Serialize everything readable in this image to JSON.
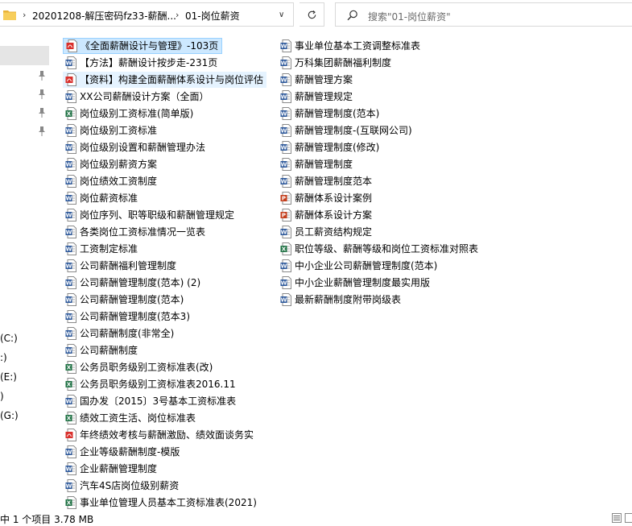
{
  "address": {
    "crumbs": [
      "20201208-解压密码fz33-薪酬...",
      "01-岗位薪资"
    ],
    "separator": "›"
  },
  "search": {
    "placeholder": "搜索\"01-岗位薪资\""
  },
  "nav": {
    "drives": [
      "(C:)",
      ":)",
      "(E:)",
      ")",
      "(G:)"
    ]
  },
  "files_col1": [
    {
      "name": "《全面薪酬设计与管理》-103页",
      "type": "pdf",
      "state": "selected"
    },
    {
      "name": "【方法】薪酬设计按步走-231页",
      "type": "word",
      "state": ""
    },
    {
      "name": "【资料】构建全面薪酬体系设计与岗位评估",
      "type": "pdf",
      "state": "hover"
    },
    {
      "name": "XX公司薪酬设计方案（全面）",
      "type": "word",
      "state": ""
    },
    {
      "name": "岗位级别工资标准(简单版)",
      "type": "excel",
      "state": ""
    },
    {
      "name": "岗位级别工资标准",
      "type": "word",
      "state": ""
    },
    {
      "name": "岗位级别设置和薪酬管理办法",
      "type": "word",
      "state": ""
    },
    {
      "name": "岗位级别薪资方案",
      "type": "word",
      "state": ""
    },
    {
      "name": "岗位绩效工资制度",
      "type": "word",
      "state": ""
    },
    {
      "name": "岗位薪资标准",
      "type": "word",
      "state": ""
    },
    {
      "name": "岗位序列、职等职级和薪酬管理规定",
      "type": "word",
      "state": ""
    },
    {
      "name": "各类岗位工资标准情况一览表",
      "type": "word",
      "state": ""
    },
    {
      "name": "工资制定标准",
      "type": "word",
      "state": ""
    },
    {
      "name": "公司薪酬福利管理制度",
      "type": "word",
      "state": ""
    },
    {
      "name": "公司薪酬管理制度(范本) (2)",
      "type": "word",
      "state": ""
    },
    {
      "name": "公司薪酬管理制度(范本)",
      "type": "word",
      "state": ""
    },
    {
      "name": "公司薪酬管理制度(范本3)",
      "type": "word",
      "state": ""
    },
    {
      "name": "公司薪酬制度(非常全)",
      "type": "word",
      "state": ""
    },
    {
      "name": "公司薪酬制度",
      "type": "word",
      "state": ""
    },
    {
      "name": "公务员职务级别工资标准表(改)",
      "type": "excel",
      "state": ""
    },
    {
      "name": "公务员职务级别工资标准表2016.11",
      "type": "excel",
      "state": ""
    },
    {
      "name": "国办发〔2015〕3号基本工资标准表",
      "type": "word",
      "state": ""
    },
    {
      "name": "绩效工资生活、岗位标准表",
      "type": "excel",
      "state": ""
    },
    {
      "name": "年终绩效考核与薪酬激励、绩效面谈务实",
      "type": "pdf",
      "state": ""
    },
    {
      "name": "企业等级薪酬制度-模版",
      "type": "word",
      "state": ""
    },
    {
      "name": "企业薪酬管理制度",
      "type": "word",
      "state": ""
    },
    {
      "name": "汽车4S店岗位级别薪资",
      "type": "word",
      "state": ""
    },
    {
      "name": "事业单位管理人员基本工资标准表(2021)",
      "type": "excel",
      "state": ""
    }
  ],
  "files_col2": [
    {
      "name": "事业单位基本工资调整标准表",
      "type": "word",
      "state": ""
    },
    {
      "name": "万科集团薪酬福利制度",
      "type": "word",
      "state": ""
    },
    {
      "name": "薪酬管理方案",
      "type": "word",
      "state": ""
    },
    {
      "name": "薪酬管理规定",
      "type": "word",
      "state": ""
    },
    {
      "name": "薪酬管理制度(范本)",
      "type": "word",
      "state": ""
    },
    {
      "name": "薪酬管理制度-(互联网公司)",
      "type": "word",
      "state": ""
    },
    {
      "name": "薪酬管理制度(修改)",
      "type": "word",
      "state": ""
    },
    {
      "name": "薪酬管理制度",
      "type": "word",
      "state": ""
    },
    {
      "name": "薪酬管理制度范本",
      "type": "word",
      "state": ""
    },
    {
      "name": "薪酬体系设计案例",
      "type": "ppt",
      "state": ""
    },
    {
      "name": "薪酬体系设计方案",
      "type": "ppt",
      "state": ""
    },
    {
      "name": "员工薪资结构规定",
      "type": "word",
      "state": ""
    },
    {
      "name": "职位等级、薪酬等级和岗位工资标准对照表",
      "type": "excel",
      "state": ""
    },
    {
      "name": "中小企业公司薪酬管理制度(范本)",
      "type": "word",
      "state": ""
    },
    {
      "name": "中小企业薪酬管理制度最实用版",
      "type": "word",
      "state": ""
    },
    {
      "name": "最新薪酬制度附带岗级表",
      "type": "word",
      "state": ""
    }
  ],
  "status": {
    "text": "中 1 个项目   3.78 MB"
  },
  "colors": {
    "word": "#2b579a",
    "excel": "#217346",
    "pdf": "#d9302c",
    "ppt": "#c43e1c",
    "selected": "#cce8ff",
    "folder": "#f4c542"
  }
}
